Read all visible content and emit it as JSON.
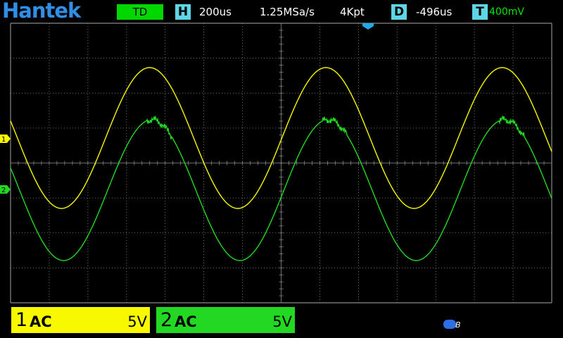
{
  "header": {
    "brand": "Hantek",
    "trigger_mode": "TD",
    "timebase_tag": "H",
    "timebase": "200us",
    "sample_rate": "1.25MSa/s",
    "memory_depth": "4Kpt",
    "delay_tag": "D",
    "delay": "-496us",
    "trigger_tag": "T",
    "trigger_level": "400mV"
  },
  "channels": [
    {
      "number": "1",
      "coupling": "AC",
      "scale": "5V",
      "color": "#f8f800",
      "marker": "1"
    },
    {
      "number": "2",
      "coupling": "AC",
      "scale": "5V",
      "color": "#22d822",
      "marker": "2"
    }
  ],
  "colors": {
    "brand": "#2f8fe6",
    "accent_tag": "#5fd6e6",
    "grid": "#8a8a8a",
    "trace_ch1": "#f8f800",
    "trace_ch2": "#22d822",
    "trigger_marker": "#23a8e8"
  },
  "icons": {
    "battery": "battery-icon",
    "trigger_position": "trigger-position-marker-icon"
  }
}
